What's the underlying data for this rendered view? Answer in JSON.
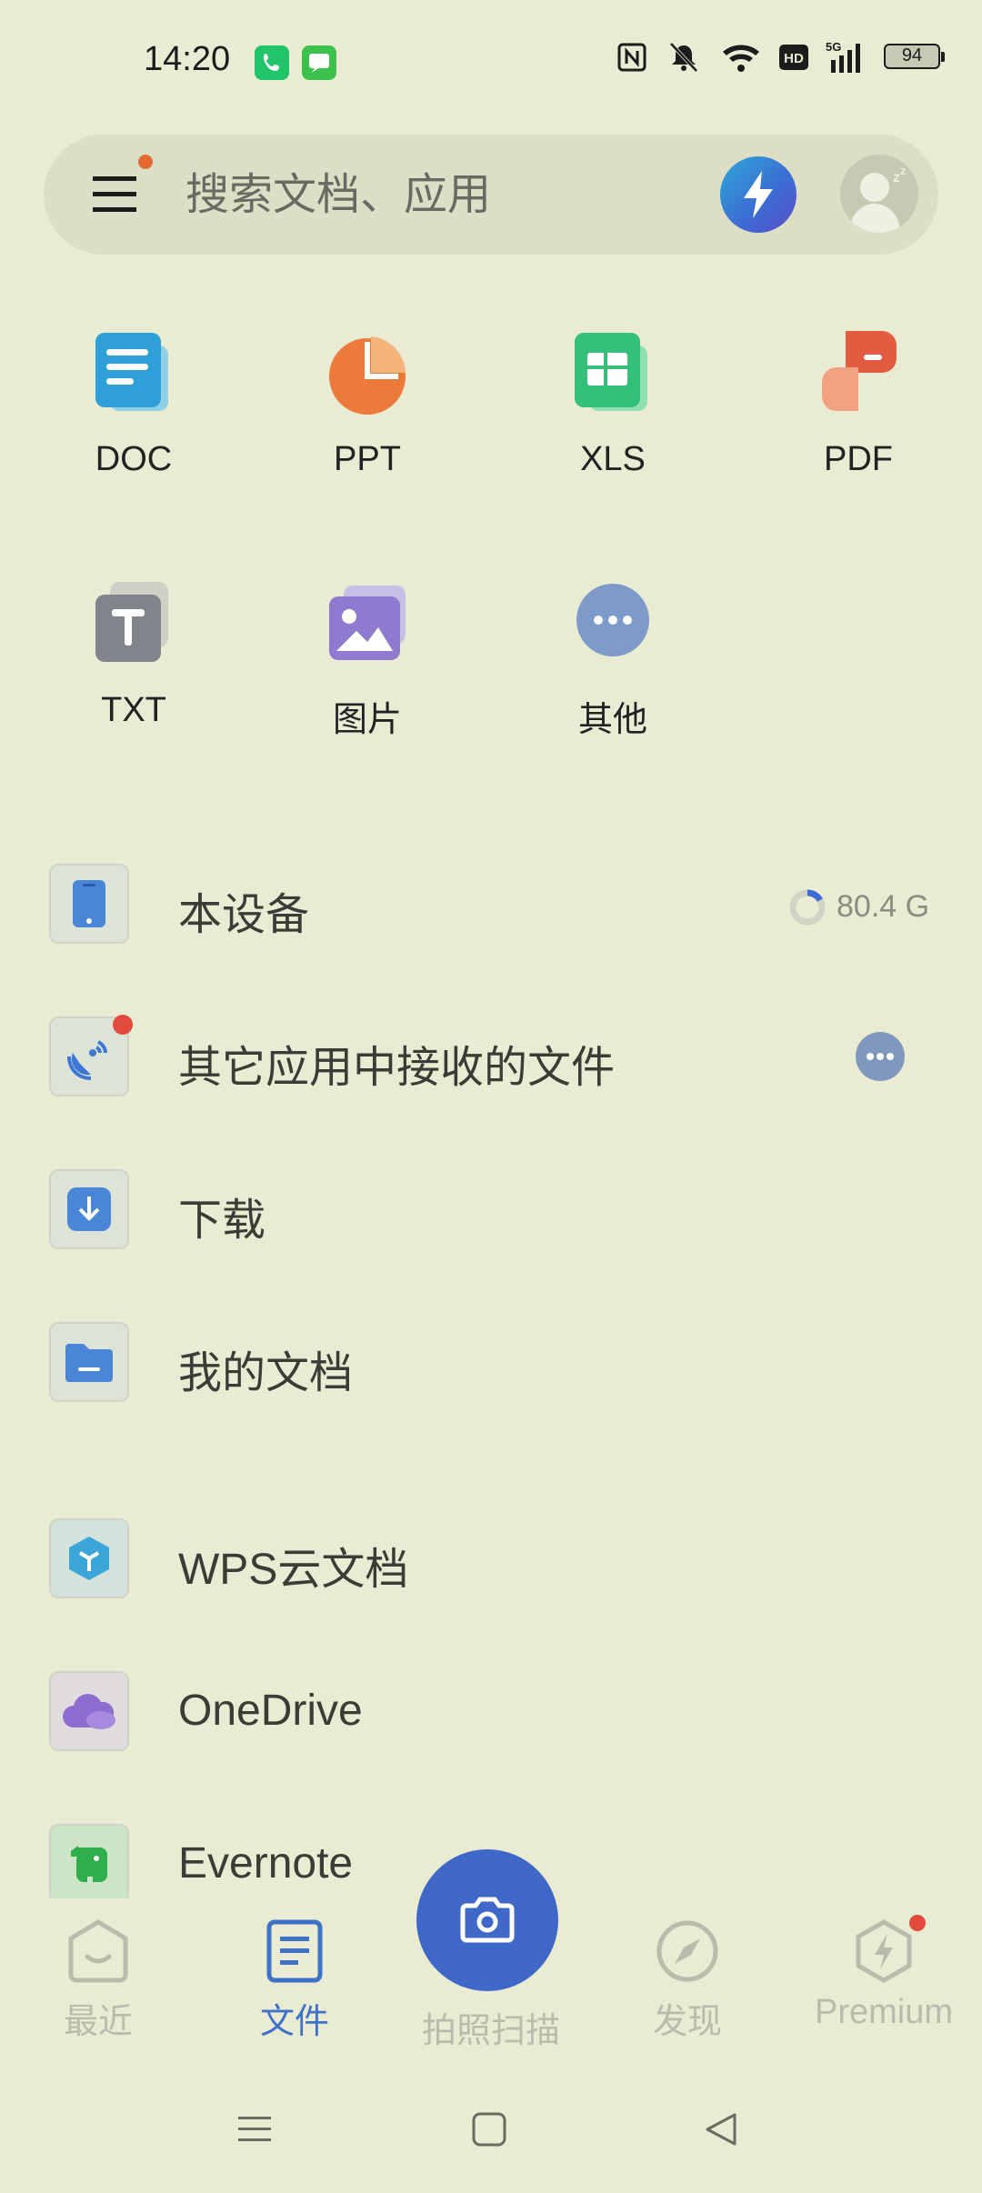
{
  "status_bar": {
    "time": "14:20",
    "battery": "94",
    "network": "5G"
  },
  "search": {
    "placeholder": "搜索文档、应用"
  },
  "file_types": [
    {
      "label": "DOC"
    },
    {
      "label": "PPT"
    },
    {
      "label": "XLS"
    },
    {
      "label": "PDF"
    },
    {
      "label": "TXT"
    },
    {
      "label": "图片"
    },
    {
      "label": "其他"
    }
  ],
  "locations": [
    {
      "label": "本设备",
      "storage": "80.4 G"
    },
    {
      "label": "其它应用中接收的文件"
    },
    {
      "label": "下载"
    },
    {
      "label": "我的文档"
    }
  ],
  "cloud": [
    {
      "label": "WPS云文档"
    },
    {
      "label": "OneDrive"
    },
    {
      "label": "Evernote"
    }
  ],
  "bottom_nav": {
    "recent": "最近",
    "files": "文件",
    "scan": "拍照扫描",
    "discover": "发现",
    "premium": "Premium"
  },
  "colors": {
    "background": "#e9ebd3",
    "accent": "#3e71c8",
    "badge": "#e24b3b"
  }
}
